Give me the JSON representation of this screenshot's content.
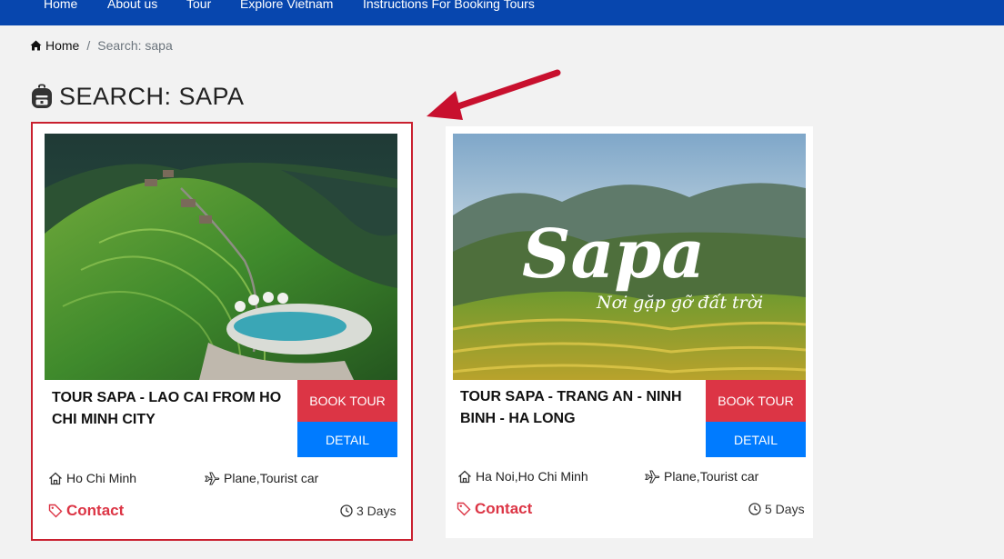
{
  "nav": {
    "items": [
      "Home",
      "About us",
      "Tour",
      "Explore Vietnam",
      "Instructions For Booking Tours"
    ]
  },
  "breadcrumb": {
    "home": "Home",
    "separator": "/",
    "current": "Search: sapa"
  },
  "page": {
    "title": "SEARCH: SAPA"
  },
  "tours": [
    {
      "title": "TOUR SAPA - LAO CAI FROM HO CHI MINH CITY",
      "book_label": "BOOK TOUR",
      "detail_label": "DETAIL",
      "departure": "Ho Chi Minh",
      "transport": "Plane,Tourist car",
      "price": "Contact",
      "duration": "3 Days",
      "highlighted": true
    },
    {
      "title": "TOUR SAPA - TRANG AN - NINH BINH - HA LONG",
      "book_label": "BOOK TOUR",
      "detail_label": "DETAIL",
      "departure": "Ha Noi,Ho Chi Minh",
      "transport": "Plane,Tourist car",
      "price": "Contact",
      "duration": "5 Days",
      "image_text": {
        "main": "Sapa",
        "sub": "Nơi gặp gỡ đất trời"
      },
      "highlighted": false
    }
  ],
  "colors": {
    "nav_bg": "#0746ae",
    "book_btn": "#dc3545",
    "detail_btn": "#007bff",
    "highlight_border": "#c9202f",
    "annotation_arrow": "#c8102e"
  }
}
